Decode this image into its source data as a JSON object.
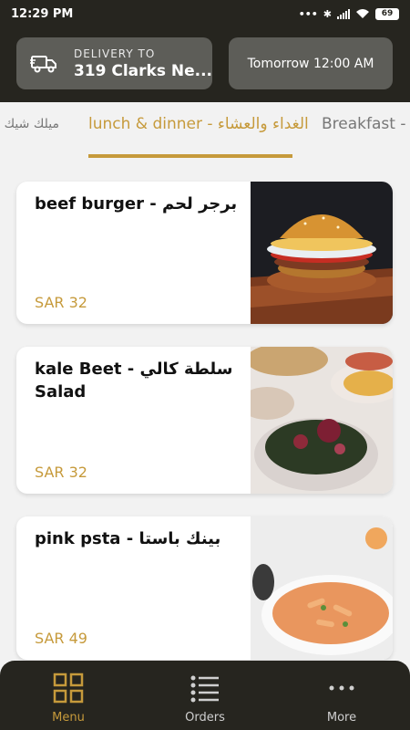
{
  "status_bar": {
    "time": "12:29 PM",
    "battery": "69"
  },
  "header": {
    "delivery_label": "DELIVERY TO",
    "delivery_address": "319 Clarks Ne...",
    "delivery_time": "Tomorrow 12:00 AM"
  },
  "tabs": [
    {
      "label": "ميلك شيك"
    },
    {
      "label": "lunch & dinner - الغداء والعشاء",
      "active": true
    },
    {
      "label": "Breakfast - فطور"
    }
  ],
  "menu_items": [
    {
      "name": "beef burger - برجر لحم",
      "price": "SAR 32"
    },
    {
      "name": "kale Beet - سلطة كالي Salad",
      "price": "SAR 32"
    },
    {
      "name": "pink psta - بينك باستا",
      "price": "SAR 49"
    }
  ],
  "bottom_nav": [
    {
      "label": "Menu",
      "active": true
    },
    {
      "label": "Orders"
    },
    {
      "label": "More"
    }
  ],
  "colors": {
    "accent": "#c69a3b",
    "dark": "#26251f",
    "button": "#5d5d58"
  }
}
